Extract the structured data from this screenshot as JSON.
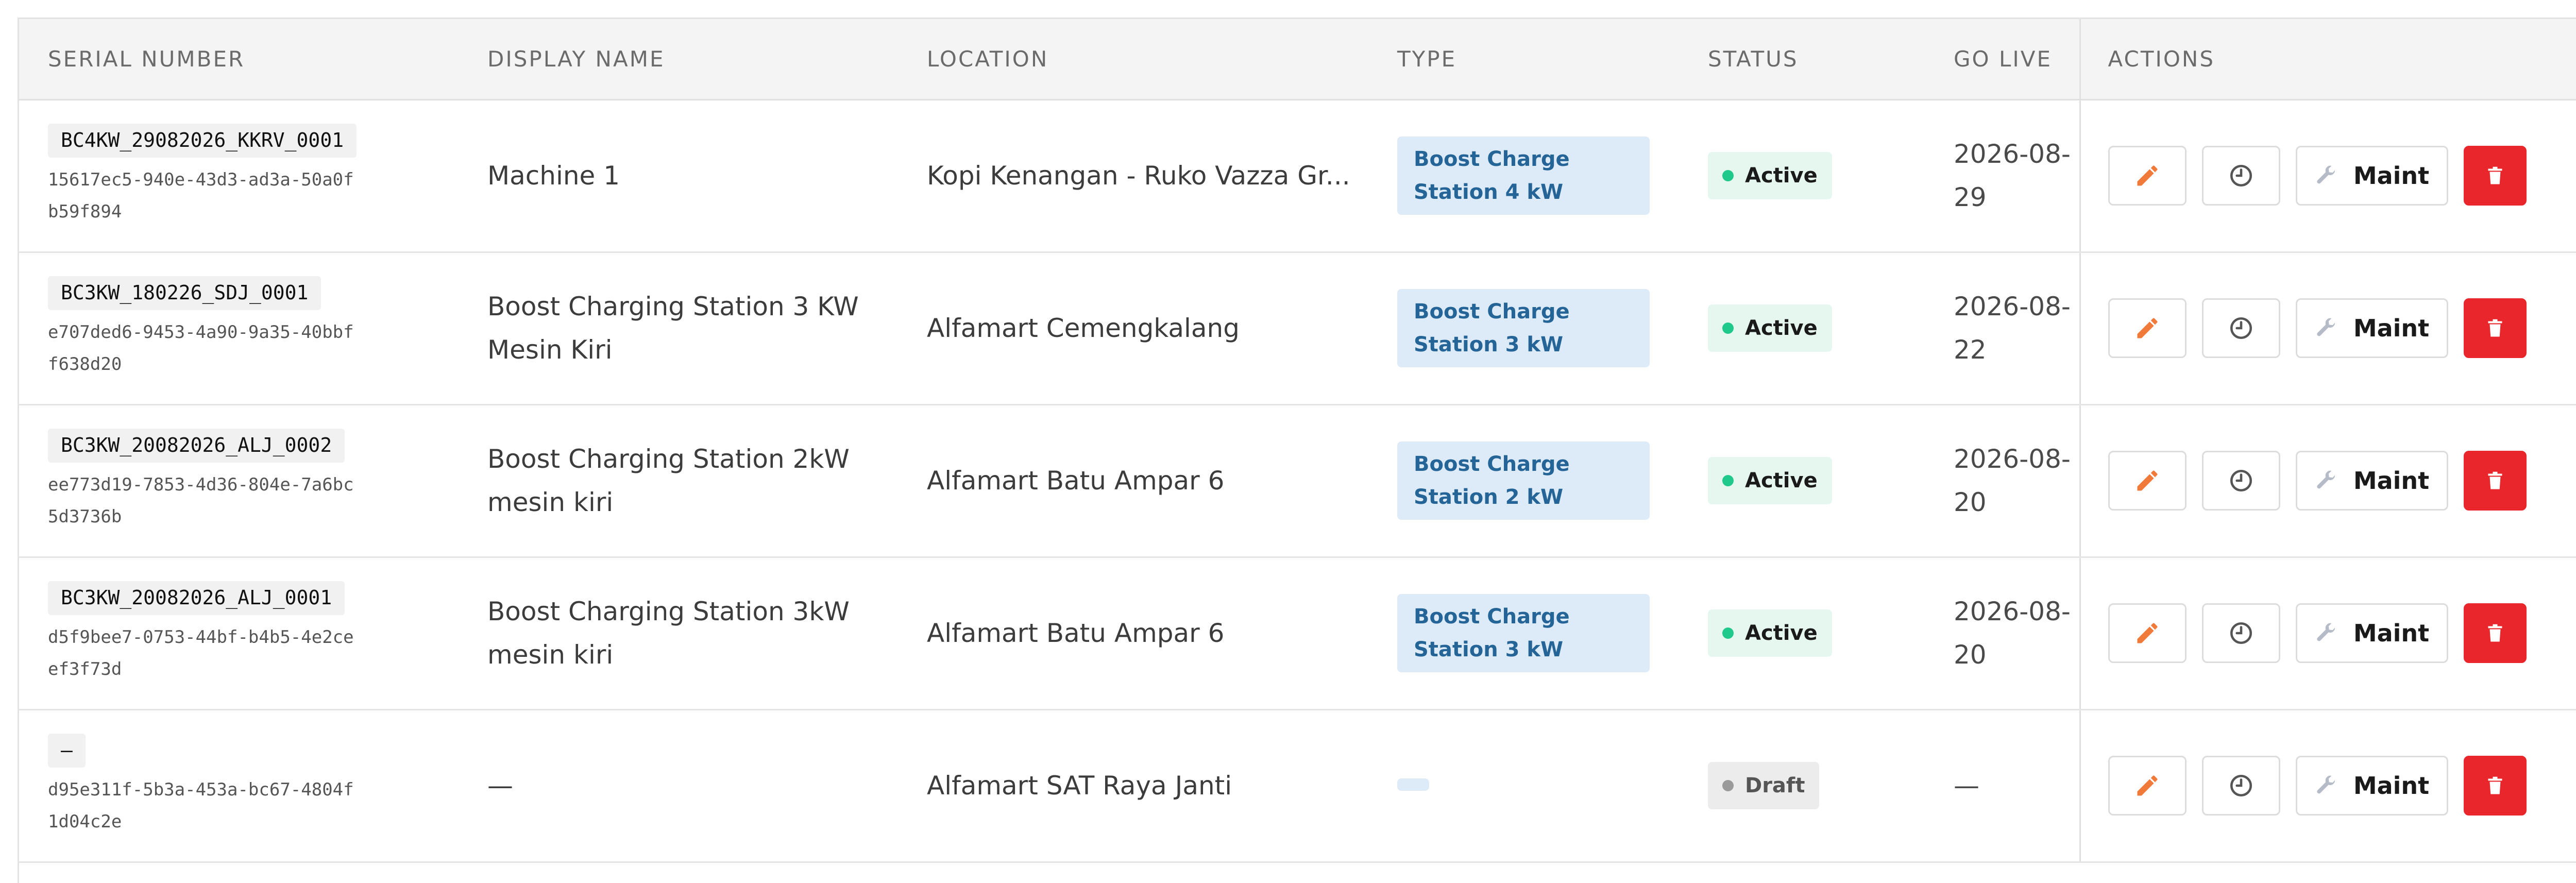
{
  "table": {
    "headers": {
      "serial": "SERIAL NUMBER",
      "name": "DISPLAY NAME",
      "location": "LOCATION",
      "type": "TYPE",
      "status": "STATUS",
      "golive": "GO LIVE",
      "actions": "ACTIONS"
    },
    "rows": [
      {
        "serial": "BC4KW_29082026_KKRV_0001",
        "uuid": "15617ec5-940e-43d3-ad3a-50a0fb59f894",
        "name": "Machine 1",
        "location": "Kopi Kenangan - Ruko Vazza Gr...",
        "type": "Boost Charge Station 4 kW",
        "status": "Active",
        "status_kind": "active",
        "golive": "2026-08-29",
        "maint_label": "Maint"
      },
      {
        "serial": "BC3KW_180226_SDJ_0001",
        "uuid": "e707ded6-9453-4a90-9a35-40bbff638d20",
        "name": "Boost Charging Station 3 KW Mesin Kiri",
        "location": "Alfamart Cemengkalang",
        "type": "Boost Charge Station 3 kW",
        "status": "Active",
        "status_kind": "active",
        "golive": "2026-08-22",
        "maint_label": "Maint"
      },
      {
        "serial": "BC3KW_20082026_ALJ_0002",
        "uuid": "ee773d19-7853-4d36-804e-7a6bc5d3736b",
        "name": "Boost Charging Station 2kW mesin kiri",
        "location": "Alfamart Batu Ampar 6",
        "type": "Boost Charge Station 2 kW",
        "status": "Active",
        "status_kind": "active",
        "golive": "2026-08-20",
        "maint_label": "Maint"
      },
      {
        "serial": "BC3KW_20082026_ALJ_0001",
        "uuid": "d5f9bee7-0753-44bf-b4b5-4e2ceef3f73d",
        "name": "Boost Charging Station 3kW mesin kiri",
        "location": "Alfamart Batu Ampar 6",
        "type": "Boost Charge Station 3 kW",
        "status": "Active",
        "status_kind": "active",
        "golive": "2026-08-20",
        "maint_label": "Maint"
      },
      {
        "serial": "—",
        "uuid": "d95e311f-5b3a-453a-bc67-4804f1d04c2e",
        "name": "—",
        "location": "Alfamart SAT Raya Janti",
        "type": "",
        "status": "Draft",
        "status_kind": "draft",
        "golive": "—",
        "maint_label": "Maint"
      }
    ]
  },
  "icons": {
    "edit": "pencil-icon",
    "history": "clock-icon",
    "maint": "wrench-icon",
    "delete": "trash-icon"
  },
  "colors": {
    "edit_icon": "#f07a3a",
    "delete_bg": "#e8262b",
    "active_dot": "#1ec98b",
    "type_badge_bg": "#ddebf8",
    "type_badge_text": "#246496"
  }
}
